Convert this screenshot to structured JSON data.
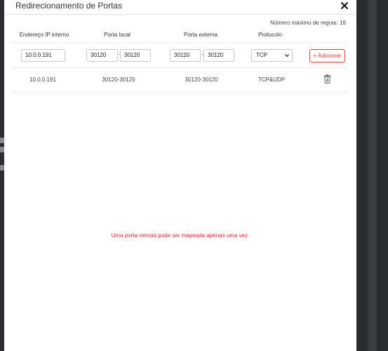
{
  "modal": {
    "title": "Redirecionamento de Portas",
    "max_rules_label": "Número máximo de regras: 16",
    "close_icon": "close-icon"
  },
  "table": {
    "headers": [
      "Endereço IP interno",
      "Porta local",
      "Porta externa",
      "Protocolo"
    ],
    "input_row": {
      "ip": "10.0.0.191",
      "local_start": "30120",
      "local_end": "30120",
      "external_start": "30120",
      "external_end": "30120",
      "protocol_selected": "TCP",
      "separator": "-",
      "add_label": "+ Adicionar"
    },
    "rules": [
      {
        "ip": "10.0.0.191",
        "local": "30120-30120",
        "external": "30120-30120",
        "protocol": "TCP&UDP",
        "delete_icon": "trash-icon"
      }
    ]
  },
  "error_message": "Uma porta remota pode ser mapeada apenas uma vez.",
  "colors": {
    "accent": "#e73838",
    "error": "#e8202a"
  }
}
